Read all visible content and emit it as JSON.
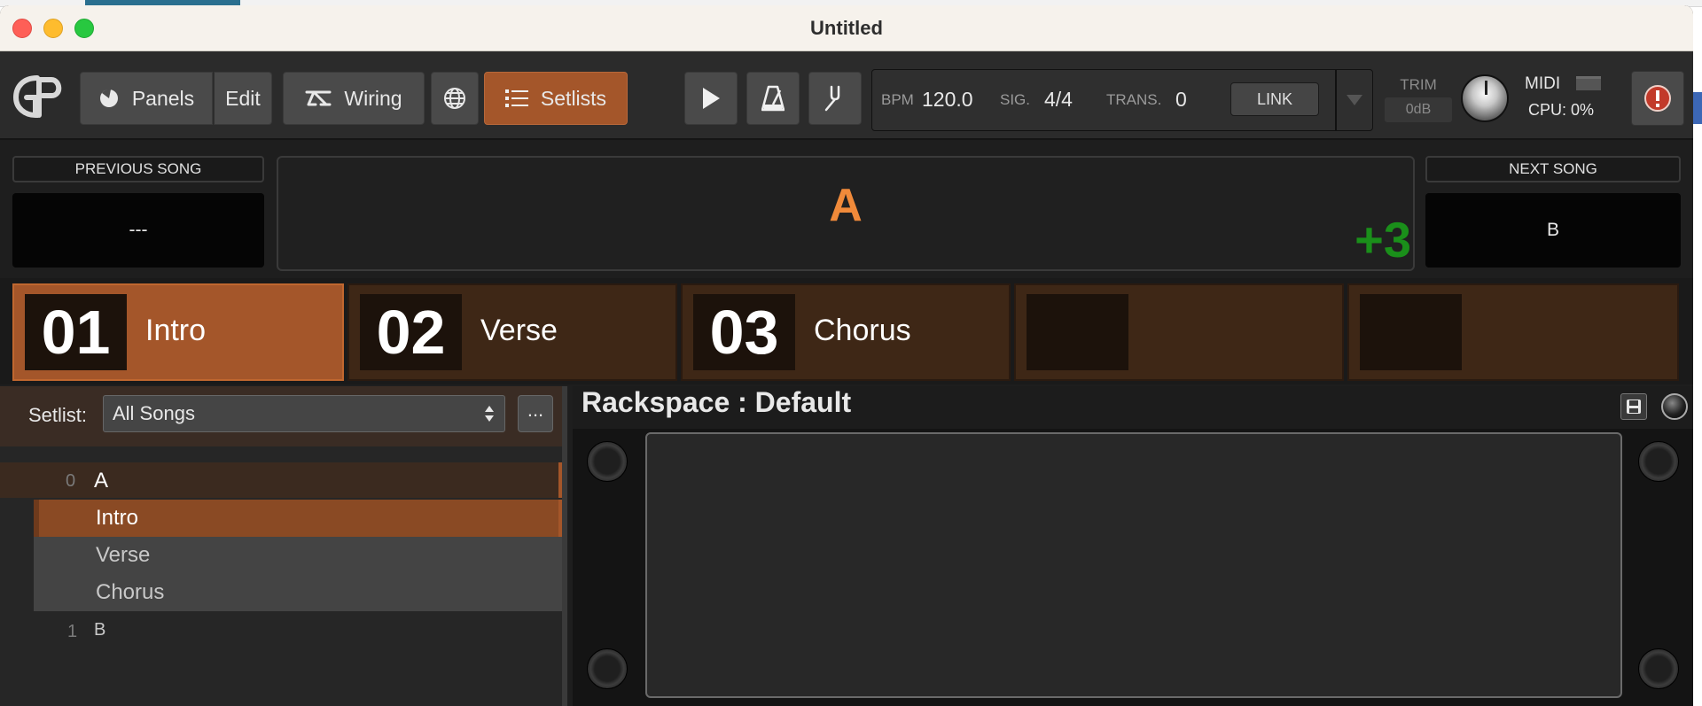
{
  "window": {
    "title": "Untitled"
  },
  "toolbar": {
    "panels_label": "Panels",
    "edit_label": "Edit",
    "wiring_label": "Wiring",
    "setlists_label": "Setlists",
    "bpm_label": "BPM",
    "bpm_value": "120.0",
    "sig_label": "SIG.",
    "sig_value": "4/4",
    "trans_label": "TRANS.",
    "trans_value": "0",
    "link_label": "LINK",
    "trim_label": "TRIM",
    "trim_value": "0dB",
    "midi_label": "MIDI",
    "cpu_label": "CPU:",
    "cpu_value": "0%"
  },
  "songs": {
    "previous_label": "PREVIOUS SONG",
    "previous_value": "---",
    "current_name": "A",
    "transpose": "+3",
    "next_label": "NEXT SONG",
    "next_value": "B"
  },
  "parts": [
    {
      "number": "01",
      "name": "Intro",
      "active": true
    },
    {
      "number": "02",
      "name": "Verse",
      "active": false
    },
    {
      "number": "03",
      "name": "Chorus",
      "active": false
    },
    {
      "number": "",
      "name": "",
      "active": false
    },
    {
      "number": "",
      "name": "",
      "active": false
    }
  ],
  "setlist": {
    "label": "Setlist:",
    "selected": "All Songs",
    "more_label": "...",
    "songs": [
      {
        "index": "0",
        "name": "A",
        "parts": [
          "Intro",
          "Verse",
          "Chorus"
        ]
      },
      {
        "index": "1",
        "name": "B"
      }
    ]
  },
  "rackspace": {
    "title": "Rackspace : Default"
  },
  "colors": {
    "accent": "#a4562a",
    "current_song": "#f08a3a",
    "transpose": "#1a8f1a"
  }
}
